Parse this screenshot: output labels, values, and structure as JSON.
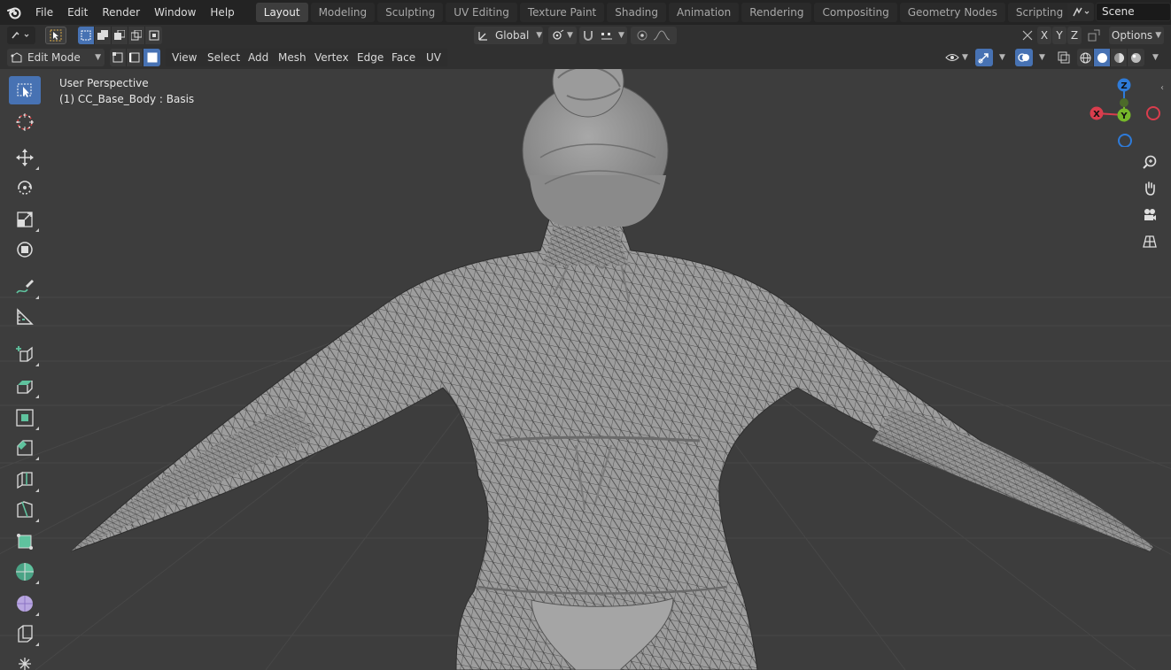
{
  "app": {
    "menus": [
      "File",
      "Edit",
      "Render",
      "Window",
      "Help"
    ],
    "workspace_tabs": [
      "Layout",
      "Modeling",
      "Sculpting",
      "UV Editing",
      "Texture Paint",
      "Shading",
      "Animation",
      "Rendering",
      "Compositing",
      "Geometry Nodes",
      "Scripting"
    ],
    "active_tab": "Layout",
    "add_tab_label": "+",
    "scene_name": "Scene"
  },
  "header": {
    "transform_orientation": "Global",
    "axis_x": "X",
    "axis_y": "Y",
    "axis_z": "Z",
    "options_label": "Options",
    "mode": "Edit Mode",
    "menus": [
      "View",
      "Select",
      "Add",
      "Mesh",
      "Vertex",
      "Edge",
      "Face",
      "UV"
    ]
  },
  "viewport": {
    "view_name": "User Perspective",
    "object_info": "(1) CC_Base_Body : Basis",
    "gizmo": {
      "z": "Z",
      "y": "Y",
      "x": "X"
    },
    "background_color": "#3d3d3d",
    "grid_color": "#474747",
    "mesh_color": "#9a9a9a",
    "wire_color": "#2a2a2a"
  },
  "toolbar": {
    "tools": [
      "select-box",
      "cursor",
      "move",
      "rotate",
      "scale",
      "transform",
      "annotate",
      "measure",
      "add-cube",
      "extrude",
      "inset",
      "bevel",
      "loop-cut",
      "knife",
      "poly-build",
      "spin",
      "smooth",
      "edge-slide",
      "shrink-fatten"
    ]
  },
  "colors": {
    "accent": "#4772b3",
    "axis_x": "#d93d4d",
    "axis_y": "#76b82a",
    "axis_z": "#2e7bd9"
  }
}
